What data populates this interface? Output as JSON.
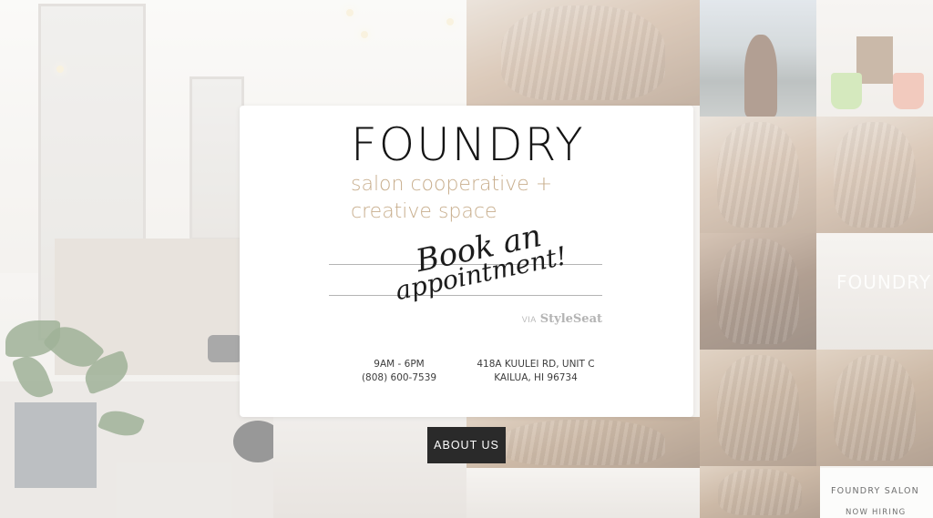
{
  "brand": {
    "name": "FOUNDRY",
    "tagline": "salon cooperative + creative space"
  },
  "booking": {
    "line1": "Book an",
    "line2": "appointment!",
    "via_label": "VIA",
    "via_brand": "StyleSeat"
  },
  "contact": {
    "hours": "9AM - 6PM",
    "phone": "(808) 600-7539",
    "address_line1": "418A KUULEI RD, UNIT C",
    "address_line2": "KAILUA, HI 96734"
  },
  "about_button": "ABOUT US",
  "tiles": {
    "logo_overlay": "FOUNDRY",
    "hiring_line1": "FOUNDRY SALON",
    "hiring_line2": "NOW HIRING"
  },
  "colors": {
    "tagline": "#c8ae8d",
    "button_bg": "#2a2a2a",
    "card_bg": "#ffffff"
  }
}
